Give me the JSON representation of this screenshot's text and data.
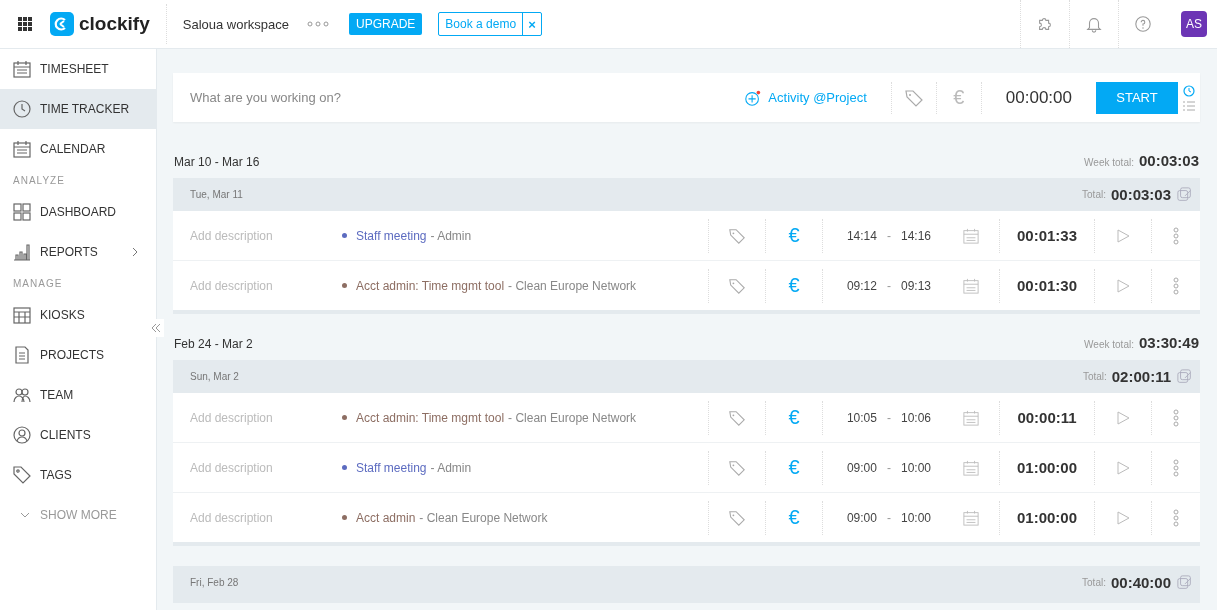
{
  "topbar": {
    "logo": "clockify",
    "workspace": "Saloua workspace",
    "upgrade": "UPGRADE",
    "demo": "Book a demo",
    "demo_close": "×",
    "avatar": "AS"
  },
  "sidebar": {
    "items": [
      {
        "kind": "item",
        "label": "TIMESHEET",
        "selected": false
      },
      {
        "kind": "item",
        "label": "TIME TRACKER",
        "selected": true
      },
      {
        "kind": "item",
        "label": "CALENDAR",
        "selected": false
      },
      {
        "kind": "heading",
        "label": "ANALYZE"
      },
      {
        "kind": "item",
        "label": "DASHBOARD",
        "selected": false
      },
      {
        "kind": "item",
        "label": "REPORTS",
        "selected": false,
        "submenu": true
      },
      {
        "kind": "heading",
        "label": "MANAGE"
      },
      {
        "kind": "item",
        "label": "KIOSKS",
        "selected": false
      },
      {
        "kind": "item",
        "label": "PROJECTS",
        "selected": false
      },
      {
        "kind": "item",
        "label": "TEAM",
        "selected": false
      },
      {
        "kind": "item",
        "label": "CLIENTS",
        "selected": false
      },
      {
        "kind": "item",
        "label": "TAGS",
        "selected": false
      },
      {
        "kind": "more",
        "label": "SHOW MORE"
      }
    ]
  },
  "tracker": {
    "placeholder": "What are you working on?",
    "project": "Activity @Project",
    "currency": "€",
    "billable": false,
    "timer": "00:00:00",
    "start": "START"
  },
  "weeks": [
    {
      "range": "Mar 10 - Mar 16",
      "total_label": "Week total:",
      "total": "00:03:03",
      "days": [
        {
          "date": "Tue, Mar 11",
          "total_label": "Total:",
          "total": "00:03:03",
          "entries": [
            {
              "placeholder": "Add description",
              "project": "Staff meeting",
              "color": "#5c6bc0",
              "client": "- Admin",
              "currency": "€",
              "billable": true,
              "start": "14:14",
              "sep": "-",
              "end": "14:16",
              "duration": "00:01:33"
            },
            {
              "placeholder": "Add description",
              "project": "Acct admin: Time mgmt tool",
              "color": "#8d6e63",
              "client": "- Clean Europe Network",
              "currency": "€",
              "billable": true,
              "start": "09:12",
              "sep": "-",
              "end": "09:13",
              "duration": "00:01:30"
            }
          ]
        }
      ]
    },
    {
      "range": "Feb 24 - Mar 2",
      "total_label": "Week total:",
      "total": "03:30:49",
      "days": [
        {
          "date": "Sun, Mar 2",
          "total_label": "Total:",
          "total": "02:00:11",
          "entries": [
            {
              "placeholder": "Add description",
              "project": "Acct admin: Time mgmt tool",
              "color": "#8d6e63",
              "client": "- Clean Europe Network",
              "currency": "€",
              "billable": true,
              "start": "10:05",
              "sep": "-",
              "end": "10:06",
              "duration": "00:00:11"
            },
            {
              "placeholder": "Add description",
              "project": "Staff meeting",
              "color": "#5c6bc0",
              "client": "- Admin",
              "currency": "€",
              "billable": true,
              "start": "09:00",
              "sep": "-",
              "end": "10:00",
              "duration": "01:00:00"
            },
            {
              "placeholder": "Add description",
              "project": "Acct admin",
              "color": "#8d6e63",
              "client": "- Clean Europe Network",
              "currency": "€",
              "billable": true,
              "start": "09:00",
              "sep": "-",
              "end": "10:00",
              "duration": "01:00:00"
            }
          ]
        },
        {
          "date": "Fri, Feb 28",
          "total_label": "Total:",
          "total": "00:40:00"
        }
      ]
    }
  ]
}
